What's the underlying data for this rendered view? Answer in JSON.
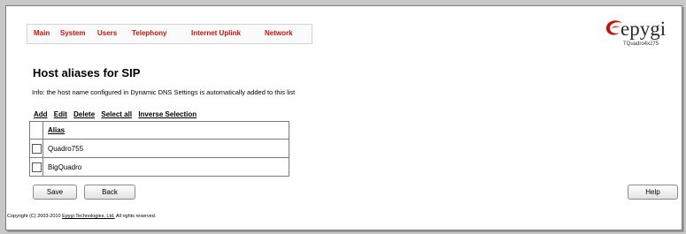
{
  "nav": {
    "items": [
      "Main",
      "System",
      "Users",
      "Telephony",
      "Internet Uplink",
      "Network"
    ]
  },
  "logo": {
    "brand": "epygi",
    "device": "TQuadro4x275",
    "accent_color": "#c0140e"
  },
  "page": {
    "title": "Host aliases for SIP",
    "info": "Info: the host name configured in Dynamic DNS Settings is automatically added to this list"
  },
  "actions": {
    "add": "Add",
    "edit": "Edit",
    "delete": "Delete",
    "select_all": "Select all",
    "inverse_selection": "Inverse Selection"
  },
  "table": {
    "column_alias": "Alias",
    "rows": [
      "Quadro755",
      "BigQuadro"
    ]
  },
  "buttons": {
    "save": "Save",
    "back": "Back",
    "help": "Help"
  },
  "footer": {
    "prefix": "Copyright (C) 2003-2010",
    "company": "Epygi Technologies, Ltd.",
    "suffix": "All rights reserved."
  }
}
